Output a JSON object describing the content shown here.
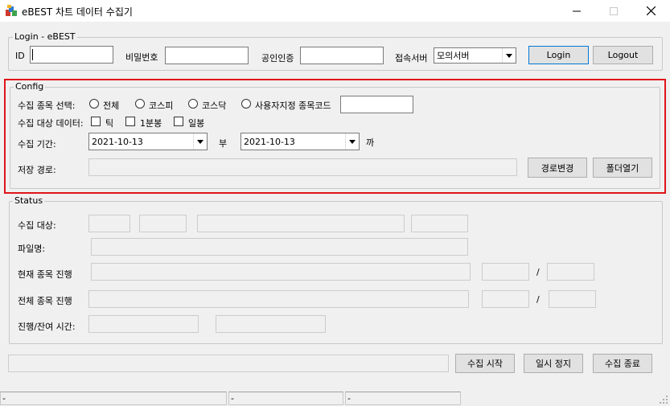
{
  "window": {
    "title": "eBEST 차트 데이터 수집기",
    "minimize_icon": "minimize-icon",
    "maximize_icon": "maximize-icon",
    "close_icon": "close-icon"
  },
  "login": {
    "group_label": "Login - eBEST",
    "id_label": "ID",
    "id_value": "",
    "password_label": "비밀번호",
    "password_value": "",
    "cert_label": "공인인증",
    "cert_value": "",
    "server_label": "접속서버",
    "server_value": "모의서버",
    "login_button": "Login",
    "logout_button": "Logout"
  },
  "config": {
    "group_label": "Config",
    "highlight_color": "#e0141b",
    "select_label": "수집 종목 선택:",
    "radio_all": "전체",
    "radio_kospi": "코스피",
    "radio_kosdaq": "코스닥",
    "radio_custom": "사용자지정 종목코드",
    "custom_code_value": "",
    "data_label": "수집 대상 데이터:",
    "check_tick": "틱",
    "check_1min": "1분봉",
    "check_daily": "일봉",
    "period_label": "수집 기간:",
    "start_date": "2021-10-13",
    "from_label": "부",
    "end_date": "2021-10-13",
    "to_label": "까",
    "path_label": "저장 경로:",
    "path_value": "",
    "change_path_button": "경로변경",
    "open_folder_button": "폴더열기"
  },
  "status": {
    "group_label": "Status",
    "target_label": "수집 대상:",
    "filename_label": "파일명:",
    "current_label": "현재 종목 진행",
    "current_sep": "/",
    "total_label": "전체 종목 진행",
    "total_sep": "/",
    "time_label": "진행/잔여 시간:"
  },
  "bottom": {
    "progress_value": "",
    "start_button": "수집 시작",
    "pause_button": "일시 정지",
    "stop_button": "수집 종료"
  },
  "statusbar": {
    "cell1": "-",
    "cell2": "-",
    "cell3": "-"
  }
}
